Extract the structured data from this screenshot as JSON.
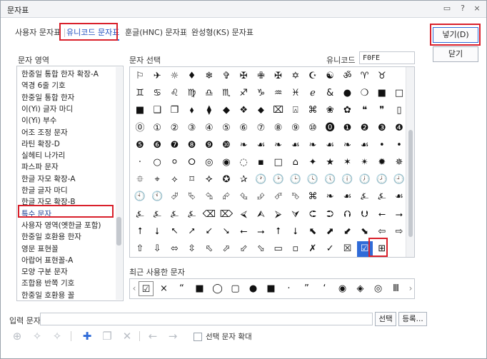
{
  "window": {
    "title": "문자표",
    "help_label": "?",
    "close_label": "×",
    "tray_label": "▭"
  },
  "tabs": [
    {
      "label": "사용자 문자표"
    },
    {
      "label": "유니코드 문자표"
    },
    {
      "label": "훈글(HNC) 문자표"
    },
    {
      "label": "완성형(KS) 문자표"
    }
  ],
  "buttons": {
    "insert": "넣기(D)",
    "close": "닫기",
    "convert": "선택",
    "register": "등록..."
  },
  "left_panel": {
    "label": "문자 영역"
  },
  "areas": [
    "한중일 통합 한자 확장-A",
    "역경 6줄 기호",
    "한중일 통합 한자",
    "이(Yi) 글자 마디",
    "이(Yi) 부수",
    "어조 조정 문자",
    "라틴 확장-D",
    "실헤티 나가리",
    "파스파 문자",
    "한글 자모 확장-A",
    "한글 글자 마디",
    "한글 자모 확장-B",
    "특수 문자",
    "사용자 영역(옛한글 포함)",
    "한중일 호환용 한자",
    "영문 표현꼴",
    "아랍어 표현꼴-A",
    "모양 구분 문자",
    "조합용 반쪽 기호",
    "한중일 호환용 꼴"
  ],
  "selected_area": "특수 문자",
  "right_panel": {
    "label": "문자 선택",
    "unicode_label": "유니코드",
    "unicode_value": "F0FE"
  },
  "char_rows": [
    [
      "⚐",
      "✈",
      "☼",
      "♦",
      "❄",
      "✞",
      "✠",
      "✙",
      "✠",
      "✡",
      "☪",
      "☯",
      "ॐ",
      "♈",
      "♉"
    ],
    [
      "♊",
      "♋",
      "♌",
      "♍",
      "♎",
      "♏",
      "♐",
      "♑",
      "♒",
      "♓",
      "ℯ",
      "&",
      "●",
      "❍",
      "■",
      "□"
    ],
    [
      "■",
      "❑",
      "❒",
      "⬧",
      "⧫",
      "◆",
      "❖",
      "⬥",
      "⌧",
      "⍓",
      "⌘",
      "❀",
      "✿",
      "❝",
      "❞",
      "▯"
    ],
    [
      "⓪",
      "①",
      "②",
      "③",
      "④",
      "⑤",
      "⑥",
      "⑦",
      "⑧",
      "⑨",
      "⑩",
      "⓿",
      "❶",
      "❷",
      "❸",
      "❹"
    ],
    [
      "❺",
      "❻",
      "❼",
      "❽",
      "❾",
      "❿",
      "❧",
      "☙",
      "❧",
      "☙",
      "❧",
      "☙",
      "❧",
      "☙",
      "•",
      "•"
    ],
    [
      "·",
      "○",
      "⚪",
      "⭘",
      "◎",
      "◉",
      "◌",
      "▪",
      "□",
      "⌂",
      "✦",
      "★",
      "✶",
      "✴",
      "✹",
      "✵"
    ],
    [
      "⯐",
      "⌖",
      "⟡",
      "⌑",
      "⯎",
      "✪",
      "✰",
      "🕐",
      "🕑",
      "🕒",
      "🕓",
      "🕔",
      "🕕",
      "🕖",
      "🕗",
      "🕘"
    ],
    [
      "🕙",
      "🕚",
      "⮰",
      "⮱",
      "⮲",
      "⮳",
      "⮴",
      "⮵",
      "⮶",
      "⮷",
      "⌘",
      "❧",
      "☙",
      "⍼",
      "⍼",
      "☙"
    ],
    [
      "⍼",
      "⍼",
      "⍼",
      "⍼",
      "⌫",
      "⌦",
      "⮘",
      "⮙",
      "⮚",
      "⮛",
      "⮈",
      "⮊",
      "⮉",
      "⮋",
      "⭠",
      "⭢"
    ],
    [
      "⭡",
      "⭣",
      "⭦",
      "⭧",
      "⭩",
      "⭨",
      "⭠",
      "⭢",
      "⭡",
      "⭣",
      "⬉",
      "⬈",
      "⬋",
      "⬊",
      "⇦",
      "⇨"
    ],
    [
      "⇧",
      "⇩",
      "⬄",
      "⇳",
      "⬁",
      "⬀",
      "⬃",
      "⬂",
      "▭",
      "▫",
      "✗",
      "✓",
      "☒",
      "☑",
      "⊞"
    ]
  ],
  "selected_char": "☑",
  "recent": {
    "label": "최근 사용한 문자",
    "chars": [
      "☑",
      "×",
      "“",
      "■",
      "◯",
      "▢",
      "●",
      "■",
      "·",
      "”",
      "‘",
      "◉",
      "◈",
      "◎",
      "Ⅲ"
    ]
  },
  "bottom": {
    "input_label": "입력 문자",
    "input_value": "",
    "expand_label": "선택 문자 확대"
  },
  "toolbar_icons": [
    "add-icon",
    "add-sparkle-icon",
    "remove-sparkle-icon",
    "plus-icon",
    "copy-icon",
    "delete-icon",
    "arrow-left-icon",
    "arrow-right-icon"
  ]
}
